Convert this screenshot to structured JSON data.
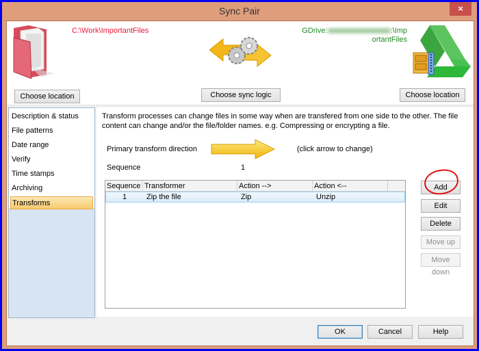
{
  "window": {
    "title": "Sync Pair",
    "close_label": "×"
  },
  "header": {
    "left_path": "C:\\Work\\ImportantFiles",
    "right_path_prefix": "GDrive:",
    "right_path_suffix_line1": ":\\Imp",
    "right_path_line2": "ortantFiles",
    "left_choose_label": "Choose location",
    "sync_logic_label": "Choose sync logic",
    "right_choose_label": "Choose location",
    "left_path_color": "#e8173a",
    "right_path_color": "#1f8a1f"
  },
  "sidebar": {
    "items": [
      {
        "label": "Description & status",
        "selected": false
      },
      {
        "label": "File patterns",
        "selected": false
      },
      {
        "label": "Date range",
        "selected": false
      },
      {
        "label": "Verify",
        "selected": false
      },
      {
        "label": "Time stamps",
        "selected": false
      },
      {
        "label": "Archiving",
        "selected": false
      },
      {
        "label": "Transforms",
        "selected": true
      }
    ]
  },
  "transforms": {
    "description": "Transform processes can change files in some way when are transfered from one side to the other.  The file content can change and/or the file/folder names.  e.g. Compressing or encrypting a file.",
    "direction_label": "Primary transform direction",
    "direction_hint": "(click arrow to change)",
    "sequence_label": "Sequence",
    "sequence_value": "1",
    "table": {
      "columns": [
        "Sequence",
        "Transformer",
        "Action -->",
        "Action <--"
      ],
      "rows": [
        {
          "sequence": "1",
          "transformer": "Zip the file",
          "action_forward": "Zip",
          "action_back": "Unzip"
        }
      ]
    },
    "buttons": {
      "add": "Add",
      "edit": "Edit",
      "delete": "Delete",
      "move_up": "Move up",
      "move_down": "Move down"
    }
  },
  "footer": {
    "ok": "OK",
    "cancel": "Cancel",
    "help": "Help"
  }
}
